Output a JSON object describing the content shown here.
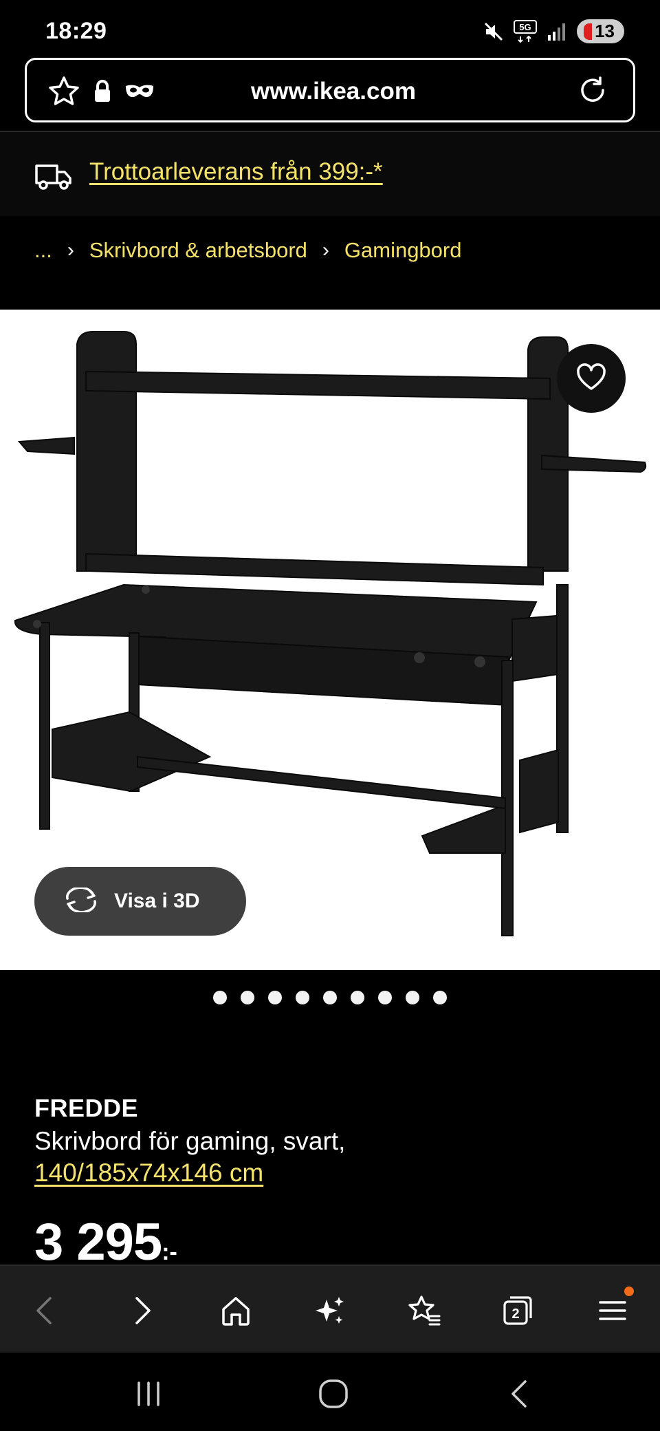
{
  "status_bar": {
    "time": "18:29",
    "network": "5G",
    "notification_count": "13",
    "icons": [
      "mute-icon",
      "5g-icon",
      "signal-icon",
      "battery-icon"
    ]
  },
  "browser": {
    "url": "www.ikea.com",
    "icons": [
      "bookmark-star-icon",
      "lock-icon",
      "incognito-mask-icon",
      "reload-icon"
    ]
  },
  "delivery_banner": {
    "icon": "truck-icon",
    "text": "Trottoarleverans från 399:-*"
  },
  "breadcrumb": {
    "items": [
      "...",
      "Skrivbord & arbetsbord",
      "Gamingbord"
    ],
    "separator": "›"
  },
  "product_image": {
    "favorite_icon": "heart-icon",
    "view3d_label": "Visa i 3D",
    "view3d_icon": "rotate-icon",
    "slide_count": 9
  },
  "product": {
    "name": "FREDDE",
    "description": "Skrivbord för gaming, svart,",
    "dimensions": "140/185x74x146 cm",
    "price": "3 295",
    "price_suffix": ":-"
  },
  "toolbar": {
    "items": [
      "back-icon",
      "forward-icon",
      "home-icon",
      "ai-sparkle-icon",
      "bookmarks-icon",
      "tabs-icon",
      "menu-icon"
    ],
    "tab_count": "2"
  },
  "navigation": {
    "items": [
      "recent-apps-icon",
      "home-circle-icon",
      "nav-back-icon"
    ]
  },
  "colors": {
    "accent_link": "#f5e26a",
    "background": "#000000",
    "toolbar_bg": "#1e1e1e",
    "notify_dot": "#f26a1b"
  }
}
